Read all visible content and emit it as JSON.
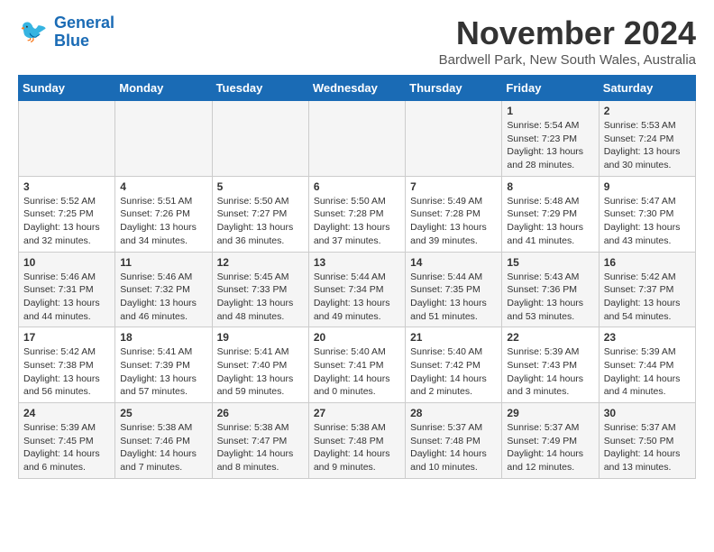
{
  "header": {
    "logo_line1": "General",
    "logo_line2": "Blue",
    "month_title": "November 2024",
    "subtitle": "Bardwell Park, New South Wales, Australia"
  },
  "days_of_week": [
    "Sunday",
    "Monday",
    "Tuesday",
    "Wednesday",
    "Thursday",
    "Friday",
    "Saturday"
  ],
  "weeks": [
    [
      {
        "day": "",
        "info": ""
      },
      {
        "day": "",
        "info": ""
      },
      {
        "day": "",
        "info": ""
      },
      {
        "day": "",
        "info": ""
      },
      {
        "day": "",
        "info": ""
      },
      {
        "day": "1",
        "info": "Sunrise: 5:54 AM\nSunset: 7:23 PM\nDaylight: 13 hours and 28 minutes."
      },
      {
        "day": "2",
        "info": "Sunrise: 5:53 AM\nSunset: 7:24 PM\nDaylight: 13 hours and 30 minutes."
      }
    ],
    [
      {
        "day": "3",
        "info": "Sunrise: 5:52 AM\nSunset: 7:25 PM\nDaylight: 13 hours and 32 minutes."
      },
      {
        "day": "4",
        "info": "Sunrise: 5:51 AM\nSunset: 7:26 PM\nDaylight: 13 hours and 34 minutes."
      },
      {
        "day": "5",
        "info": "Sunrise: 5:50 AM\nSunset: 7:27 PM\nDaylight: 13 hours and 36 minutes."
      },
      {
        "day": "6",
        "info": "Sunrise: 5:50 AM\nSunset: 7:28 PM\nDaylight: 13 hours and 37 minutes."
      },
      {
        "day": "7",
        "info": "Sunrise: 5:49 AM\nSunset: 7:28 PM\nDaylight: 13 hours and 39 minutes."
      },
      {
        "day": "8",
        "info": "Sunrise: 5:48 AM\nSunset: 7:29 PM\nDaylight: 13 hours and 41 minutes."
      },
      {
        "day": "9",
        "info": "Sunrise: 5:47 AM\nSunset: 7:30 PM\nDaylight: 13 hours and 43 minutes."
      }
    ],
    [
      {
        "day": "10",
        "info": "Sunrise: 5:46 AM\nSunset: 7:31 PM\nDaylight: 13 hours and 44 minutes."
      },
      {
        "day": "11",
        "info": "Sunrise: 5:46 AM\nSunset: 7:32 PM\nDaylight: 13 hours and 46 minutes."
      },
      {
        "day": "12",
        "info": "Sunrise: 5:45 AM\nSunset: 7:33 PM\nDaylight: 13 hours and 48 minutes."
      },
      {
        "day": "13",
        "info": "Sunrise: 5:44 AM\nSunset: 7:34 PM\nDaylight: 13 hours and 49 minutes."
      },
      {
        "day": "14",
        "info": "Sunrise: 5:44 AM\nSunset: 7:35 PM\nDaylight: 13 hours and 51 minutes."
      },
      {
        "day": "15",
        "info": "Sunrise: 5:43 AM\nSunset: 7:36 PM\nDaylight: 13 hours and 53 minutes."
      },
      {
        "day": "16",
        "info": "Sunrise: 5:42 AM\nSunset: 7:37 PM\nDaylight: 13 hours and 54 minutes."
      }
    ],
    [
      {
        "day": "17",
        "info": "Sunrise: 5:42 AM\nSunset: 7:38 PM\nDaylight: 13 hours and 56 minutes."
      },
      {
        "day": "18",
        "info": "Sunrise: 5:41 AM\nSunset: 7:39 PM\nDaylight: 13 hours and 57 minutes."
      },
      {
        "day": "19",
        "info": "Sunrise: 5:41 AM\nSunset: 7:40 PM\nDaylight: 13 hours and 59 minutes."
      },
      {
        "day": "20",
        "info": "Sunrise: 5:40 AM\nSunset: 7:41 PM\nDaylight: 14 hours and 0 minutes."
      },
      {
        "day": "21",
        "info": "Sunrise: 5:40 AM\nSunset: 7:42 PM\nDaylight: 14 hours and 2 minutes."
      },
      {
        "day": "22",
        "info": "Sunrise: 5:39 AM\nSunset: 7:43 PM\nDaylight: 14 hours and 3 minutes."
      },
      {
        "day": "23",
        "info": "Sunrise: 5:39 AM\nSunset: 7:44 PM\nDaylight: 14 hours and 4 minutes."
      }
    ],
    [
      {
        "day": "24",
        "info": "Sunrise: 5:39 AM\nSunset: 7:45 PM\nDaylight: 14 hours and 6 minutes."
      },
      {
        "day": "25",
        "info": "Sunrise: 5:38 AM\nSunset: 7:46 PM\nDaylight: 14 hours and 7 minutes."
      },
      {
        "day": "26",
        "info": "Sunrise: 5:38 AM\nSunset: 7:47 PM\nDaylight: 14 hours and 8 minutes."
      },
      {
        "day": "27",
        "info": "Sunrise: 5:38 AM\nSunset: 7:48 PM\nDaylight: 14 hours and 9 minutes."
      },
      {
        "day": "28",
        "info": "Sunrise: 5:37 AM\nSunset: 7:48 PM\nDaylight: 14 hours and 10 minutes."
      },
      {
        "day": "29",
        "info": "Sunrise: 5:37 AM\nSunset: 7:49 PM\nDaylight: 14 hours and 12 minutes."
      },
      {
        "day": "30",
        "info": "Sunrise: 5:37 AM\nSunset: 7:50 PM\nDaylight: 14 hours and 13 minutes."
      }
    ]
  ]
}
